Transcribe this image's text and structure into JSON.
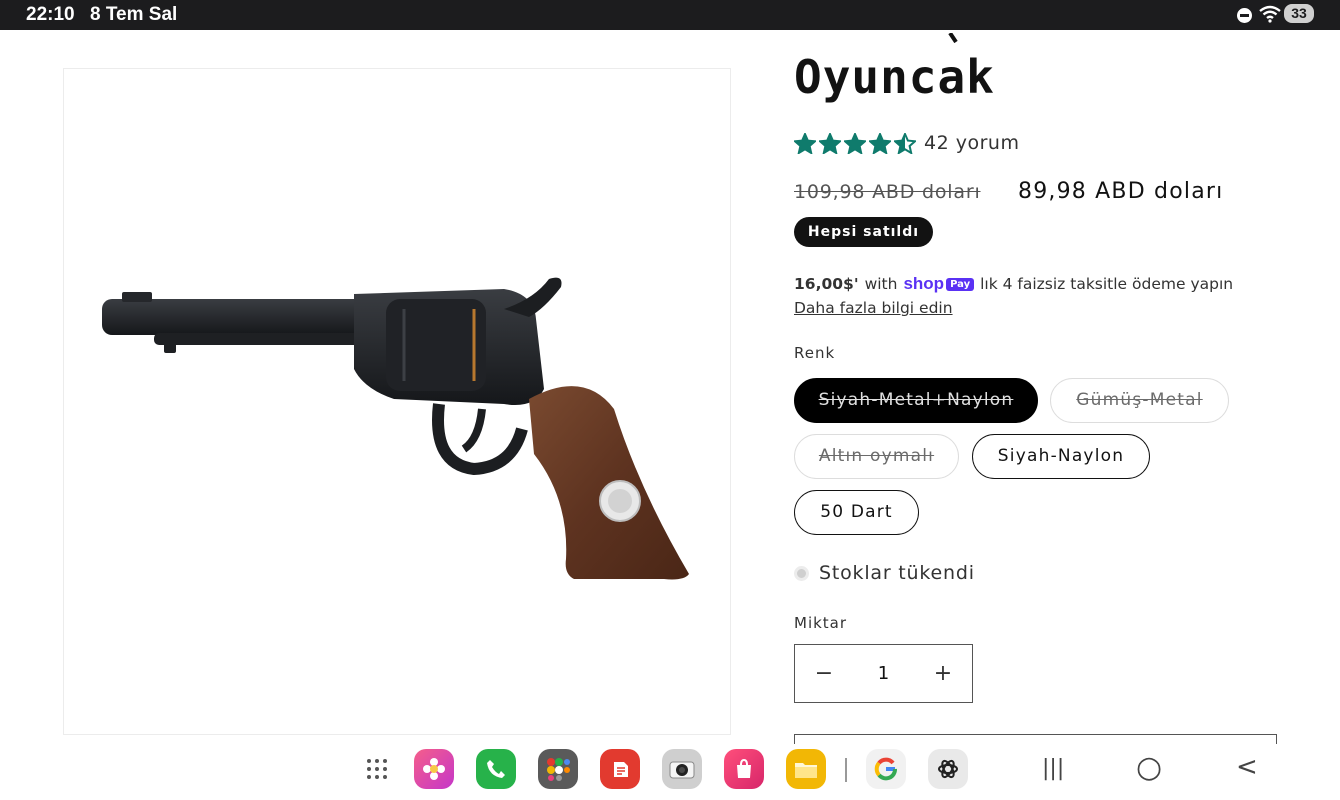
{
  "status_bar": {
    "time": "22:10",
    "date": "8 Tem Sal",
    "battery": "33"
  },
  "product": {
    "title": "Oyuncak",
    "rating": {
      "value": 4.5,
      "max": 5,
      "text": "42 yorum",
      "star_color": "#0f7b6c"
    },
    "price": {
      "regular": "109,98 ABD doları",
      "sale": "89,98 ABD doları"
    },
    "badge": "Hepsi satıldı",
    "installment": {
      "amount": "16,00$'",
      "with": "with",
      "brand": "shop",
      "pay_chip": "Pay",
      "text": "lık 4 faizsiz taksitle ödeme yapın",
      "learn_more": "Daha fazla bilgi edin"
    },
    "color_label": "Renk",
    "variants": [
      {
        "label": "Siyah-Metal+Naylon",
        "selected": true,
        "available": false
      },
      {
        "label": "Gümüş-Metal",
        "selected": false,
        "available": false
      },
      {
        "label": "Altın oymalı",
        "selected": false,
        "available": false
      },
      {
        "label": "Siyah-Naylon",
        "selected": false,
        "available": true
      },
      {
        "label": "50 Dart",
        "selected": false,
        "available": true
      }
    ],
    "stock_status": "Stoklar tükendi",
    "quantity_label": "Miktar",
    "quantity": "1",
    "qty_minus": "−",
    "qty_plus": "+"
  },
  "dock": {
    "apps": [
      {
        "name": "apps-grid-icon"
      },
      {
        "name": "gallery-icon",
        "color": "#e8407a"
      },
      {
        "name": "phone-icon",
        "color": "#27b24a"
      },
      {
        "name": "folder-apps-icon",
        "color": "#5a5a5a"
      },
      {
        "name": "notes-icon",
        "color": "#e23a2f"
      },
      {
        "name": "camera-icon",
        "color": "#cfcfcf"
      },
      {
        "name": "store-icon",
        "color": "#e8356e"
      },
      {
        "name": "files-icon",
        "color": "#f2b705"
      },
      {
        "name": "google-icon",
        "color": "#f1f1f1"
      },
      {
        "name": "chatgpt-icon",
        "color": "#e9e9e9"
      }
    ],
    "nav": {
      "recents": "|||",
      "home": "○",
      "back": "<"
    }
  }
}
